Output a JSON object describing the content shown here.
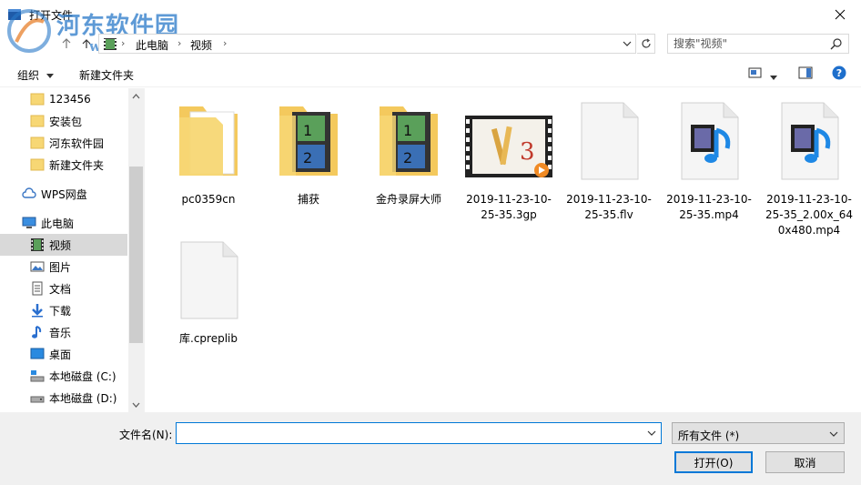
{
  "window": {
    "title": "打开文件"
  },
  "watermark": {
    "text": "河东软件园",
    "url": "www.pc0359.cn"
  },
  "address": {
    "crumbs": [
      "此电脑",
      "视频"
    ]
  },
  "search": {
    "placeholder": "搜索\"视频\""
  },
  "toolbar": {
    "organize": "组织",
    "new_folder": "新建文件夹"
  },
  "sidebar": {
    "items": [
      {
        "label": "123456",
        "icon": "folder-icon"
      },
      {
        "label": "安装包",
        "icon": "folder-icon"
      },
      {
        "label": "河东软件园",
        "icon": "folder-icon"
      },
      {
        "label": "新建文件夹",
        "icon": "folder-icon"
      },
      {
        "label": "WPS网盘",
        "icon": "cloud-icon"
      },
      {
        "label": "此电脑",
        "icon": "computer-icon"
      },
      {
        "label": "视频",
        "icon": "video-icon"
      },
      {
        "label": "图片",
        "icon": "picture-icon"
      },
      {
        "label": "文档",
        "icon": "document-icon"
      },
      {
        "label": "下载",
        "icon": "download-icon"
      },
      {
        "label": "音乐",
        "icon": "music-icon"
      },
      {
        "label": "桌面",
        "icon": "desktop-icon"
      },
      {
        "label": "本地磁盘 (C:)",
        "icon": "drive-c-icon"
      },
      {
        "label": "本地磁盘 (D:)",
        "icon": "drive-icon"
      }
    ]
  },
  "files": [
    {
      "name": "pc0359cn",
      "type": "folder-doc"
    },
    {
      "name": "捕获",
      "type": "folder-video"
    },
    {
      "name": "金舟录屏大师",
      "type": "folder-video"
    },
    {
      "name": "2019-11-23-10-25-35.3gp",
      "type": "video-thumb"
    },
    {
      "name": "2019-11-23-10-25-35.flv",
      "type": "blank"
    },
    {
      "name": "2019-11-23-10-25-35.mp4",
      "type": "media"
    },
    {
      "name": "2019-11-23-10-25-35_2.00x_640x480.mp4",
      "type": "media"
    },
    {
      "name": "库.cpreplib",
      "type": "blank"
    }
  ],
  "bottom": {
    "filename_label": "文件名(N):",
    "filename_value": "",
    "filter": "所有文件 (*)",
    "open": "打开(O)",
    "cancel": "取消"
  },
  "colors": {
    "accent": "#0078d7",
    "folder": "#f7d774",
    "selected": "#d9d9d9"
  }
}
